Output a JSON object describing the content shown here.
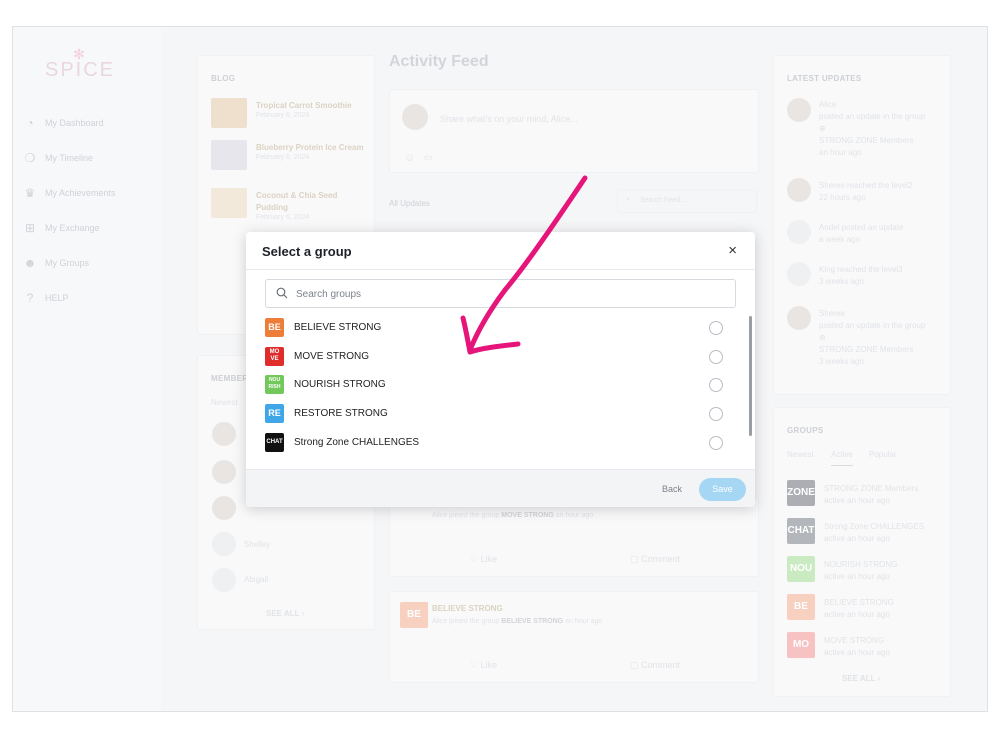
{
  "app": {
    "logo": "SPICE"
  },
  "nav": [
    {
      "label": "My Dashboard",
      "icon": "dashboard-icon"
    },
    {
      "label": "My Timeline",
      "icon": "chat-bubbles-icon"
    },
    {
      "label": "My Achievements",
      "icon": "trophy-icon"
    },
    {
      "label": "My Exchange",
      "icon": "cart-icon"
    },
    {
      "label": "My Groups",
      "icon": "people-icon"
    },
    {
      "label": "HELP",
      "icon": "question-icon"
    }
  ],
  "blog": {
    "heading": "BLOG",
    "posts": [
      {
        "title": "Tropical Carrot Smoothie",
        "date": "February 6, 2024"
      },
      {
        "title": "Blueberry Protein Ice Cream",
        "date": "February 6, 2024"
      },
      {
        "title": "Coconut & Chia Seed Pudding",
        "date": "February 6, 2024"
      }
    ]
  },
  "members": {
    "heading": "MEMBERS",
    "filter": "Newest",
    "names": [
      "Shelley",
      "Abigail"
    ],
    "see_all": "SEE ALL ›"
  },
  "feed": {
    "title": "Activity Feed",
    "composer_placeholder": "Share what's on your mind, Alice...",
    "tab": "All Updates",
    "search_placeholder": "Search Feed...",
    "post1": {
      "text": "Alice joined the group",
      "group": "MOVE STRONG",
      "time": "an hour ago"
    },
    "post2": {
      "group_title": "BELIEVE STRONG",
      "text": "Alice joined the group",
      "group": "BELIEVE STRONG",
      "time": "an hour ago"
    },
    "like": "Like",
    "comment": "Comment"
  },
  "latest": {
    "heading": "LATEST UPDATES",
    "items": [
      {
        "line1": "Alice",
        "line2": "posted an update in the group",
        "line3": "STRONG ZONE Members",
        "time": "an hour ago"
      },
      {
        "line1": "Sheree reached the level2",
        "line2": "",
        "line3": "",
        "time": "22 hours ago"
      },
      {
        "line1": "Andel posted an update",
        "line2": "",
        "line3": "",
        "time": "a week ago"
      },
      {
        "line1": "King reached the level3",
        "line2": "",
        "line3": "",
        "time": "3 weeks ago"
      },
      {
        "line1": "Sheree",
        "line2": "posted an update in the group",
        "line3": "STRONG ZONE Members",
        "time": "3 weeks ago"
      }
    ]
  },
  "groups_widget": {
    "heading": "GROUPS",
    "tabs": [
      "Newest",
      "Active",
      "Popular"
    ],
    "items": [
      {
        "name": "STRONG ZONE Members",
        "time": "active an hour ago",
        "logo": "ZONE",
        "color": "#9a9da3"
      },
      {
        "name": "Strong Zone CHALLENGES",
        "time": "active an hour ago",
        "logo": "CHAT",
        "color": "#a3a6ab"
      },
      {
        "name": "NOURISH STRONG",
        "time": "active an hour ago",
        "logo": "NOU",
        "color": "#bfe7b5"
      },
      {
        "name": "BELIEVE STRONG",
        "time": "active an hour ago",
        "logo": "BE",
        "color": "#f6c6b2"
      },
      {
        "name": "MOVE STRONG",
        "time": "active an hour ago",
        "logo": "MO",
        "color": "#f4b5b5"
      }
    ],
    "see_all": "SEE ALL ›"
  },
  "modal": {
    "title": "Select a group",
    "close": "×",
    "search_placeholder": "Search groups",
    "groups": [
      {
        "name": "BELIEVE STRONG",
        "logo": "BE",
        "color": "#ef7d3a"
      },
      {
        "name": "MOVE STRONG",
        "logo": "MO VE",
        "color": "#e12c2c"
      },
      {
        "name": "NOURISH STRONG",
        "logo": "NOU RISH",
        "color": "#72c85a"
      },
      {
        "name": "RESTORE STRONG",
        "logo": "RE",
        "color": "#3fa6e8"
      },
      {
        "name": "Strong Zone CHALLENGES",
        "logo": "CHAT",
        "color": "#111111"
      }
    ],
    "back_label": "Back",
    "save_label": "Save"
  },
  "annotation": {
    "arrow_color": "#e5157a"
  }
}
